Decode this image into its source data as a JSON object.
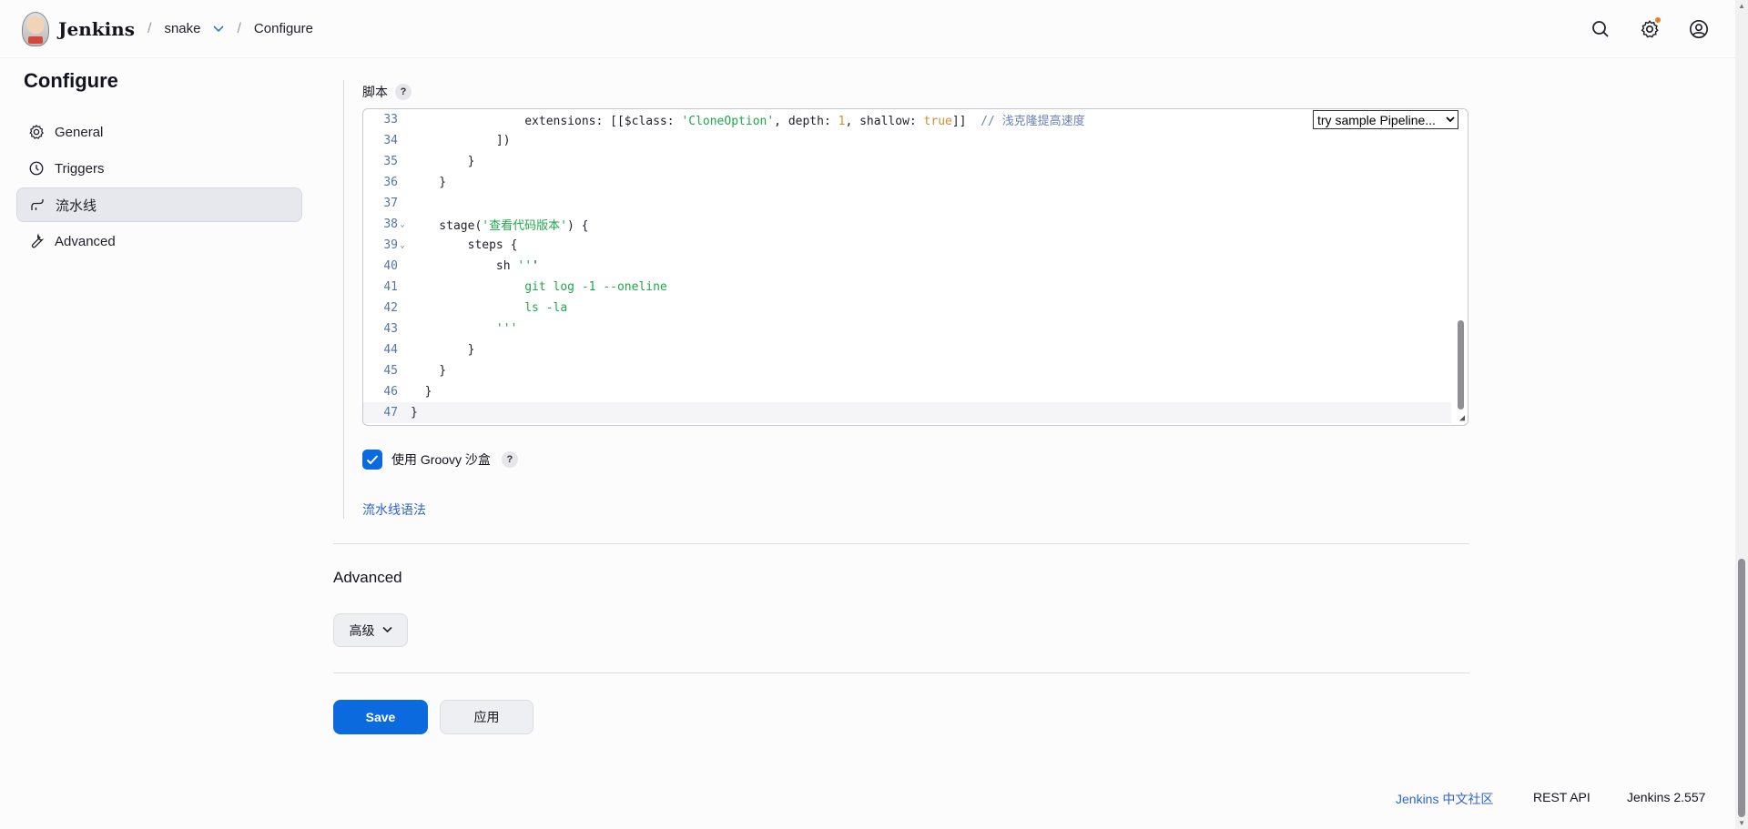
{
  "header": {
    "app_name": "Jenkins",
    "breadcrumbs": [
      "snake",
      "Configure"
    ]
  },
  "sidebar": {
    "title": "Configure",
    "items": [
      {
        "label": "General",
        "icon": "gear-icon"
      },
      {
        "label": "Triggers",
        "icon": "clock-icon"
      },
      {
        "label": "流水线",
        "icon": "pipeline-icon",
        "active": true
      },
      {
        "label": "Advanced",
        "icon": "wrench-icon"
      }
    ]
  },
  "script": {
    "label": "脚本",
    "help": "?",
    "sample_select": "try sample Pipeline...",
    "lines": [
      {
        "n": "33",
        "fold": "",
        "code": "                extensions: [[$class: 'CloneOption', depth: 1, shallow: true]]  // 浅克隆提高速度"
      },
      {
        "n": "34",
        "fold": "",
        "code": "            ])"
      },
      {
        "n": "35",
        "fold": "",
        "code": "        }"
      },
      {
        "n": "36",
        "fold": "",
        "code": "    }"
      },
      {
        "n": "37",
        "fold": "",
        "code": ""
      },
      {
        "n": "38",
        "fold": "v",
        "code": "    stage('查看代码版本') {"
      },
      {
        "n": "39",
        "fold": "v",
        "code": "        steps {"
      },
      {
        "n": "40",
        "fold": "",
        "code": "            sh '''"
      },
      {
        "n": "41",
        "fold": "",
        "code": "                git log -1 --oneline"
      },
      {
        "n": "42",
        "fold": "",
        "code": "                ls -la"
      },
      {
        "n": "43",
        "fold": "",
        "code": "            '''"
      },
      {
        "n": "44",
        "fold": "",
        "code": "        }"
      },
      {
        "n": "45",
        "fold": "",
        "code": "    }"
      },
      {
        "n": "46",
        "fold": "",
        "code": "  }"
      },
      {
        "n": "47",
        "fold": "",
        "code": "}"
      }
    ]
  },
  "groovy_sandbox": {
    "label": "使用 Groovy 沙盒",
    "checked": true,
    "help": "?"
  },
  "pipeline_syntax_link": "流水线语法",
  "advanced": {
    "title": "Advanced",
    "button_label": "高级"
  },
  "actions": {
    "save": "Save",
    "apply": "应用"
  },
  "footer": {
    "community": "Jenkins 中文社区",
    "rest_api": "REST API",
    "version": "Jenkins 2.557"
  },
  "colors": {
    "accent": "#0b6bde",
    "string": "#1fa84a",
    "number": "#d48b2c",
    "comment": "#6a7fb4"
  }
}
